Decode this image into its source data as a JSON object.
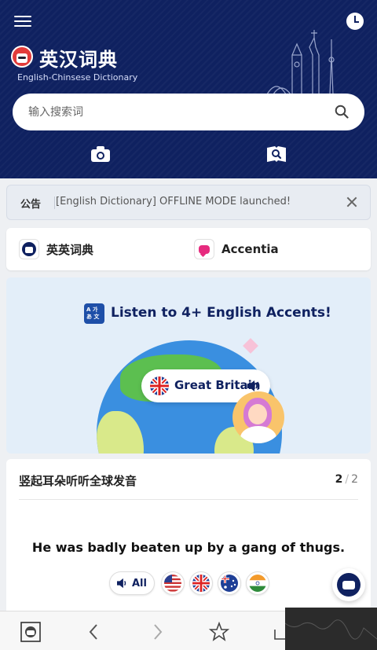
{
  "header": {
    "title": "英汉词典",
    "subtitle": "English-Chinsese Dictionary",
    "menu_icon": "hamburger-icon",
    "history_icon": "clock-icon",
    "brand_color": "#0f2160"
  },
  "search": {
    "placeholder": "输入搜索词",
    "value": ""
  },
  "tools": {
    "camera_icon": "camera-icon",
    "image_search_icon": "image-search-icon"
  },
  "notice": {
    "label": "公告",
    "text": "[English Dictionary] OFFLINE MODE launched!"
  },
  "quick_links": [
    {
      "label": "英英词典",
      "icon": "dictionary-logo-icon"
    },
    {
      "label": "Accentia",
      "icon": "accentia-icon"
    }
  ],
  "banner": {
    "icon_text": "A 가 あ 文",
    "title": "Listen to 4+ English Accents!",
    "pill_label": "Great Britain"
  },
  "pronunciation": {
    "title": "竖起耳朵听听全球发音",
    "page_current": "2",
    "page_total": "2",
    "sentence": "He was badly beaten up by a gang of thugs.",
    "all_label": "All",
    "accents": [
      "us-flag-icon",
      "uk-flag-icon",
      "australia-flag-icon",
      "india-flag-icon"
    ]
  },
  "bottom_bar": {
    "items": [
      "home-icon",
      "back-icon",
      "forward-icon",
      "star-icon",
      "share-icon"
    ]
  }
}
